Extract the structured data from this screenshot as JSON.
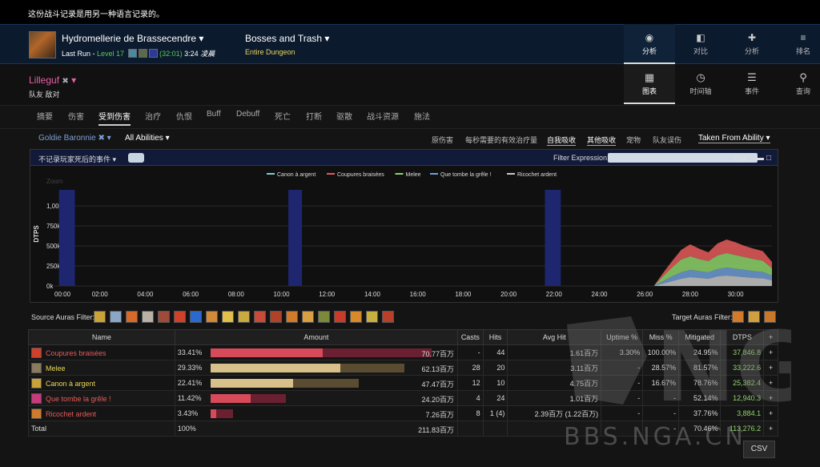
{
  "notice": "这份战斗记录是用另一种语言记录的。",
  "fight": {
    "boss_name": "Hydromellerie de Brassecendre ▾",
    "last_run": "Last Run",
    "level": "Level 17",
    "timer": "(32:01)",
    "duration": "3:24",
    "time_suffix": "凌晨",
    "category": "Bosses and Trash ▾",
    "scope": "Entire Dungeon"
  },
  "topnav": [
    {
      "label": "分析",
      "icon": "eye-icon"
    },
    {
      "label": "对比",
      "icon": "compare-icon"
    },
    {
      "label": "分析",
      "icon": "puzzle-icon"
    },
    {
      "label": "排名",
      "icon": "rank-icon"
    }
  ],
  "player": {
    "name": "Lilleguf",
    "menu": "▾",
    "sub": "队友  敌对"
  },
  "viewnav": [
    {
      "label": "图表",
      "icon": "grid-icon"
    },
    {
      "label": "时间轴",
      "icon": "clock-icon"
    },
    {
      "label": "事件",
      "icon": "list-icon"
    },
    {
      "label": "查询",
      "icon": "pin-icon"
    }
  ],
  "tabs": [
    "摘要",
    "伤害",
    "受到伤害",
    "治疗",
    "仇恨",
    "Buff",
    "Debuff",
    "死亡",
    "打断",
    "驱散",
    "战斗资源",
    "施法"
  ],
  "filters": {
    "target": "Goldie Baronnie ✖ ▾",
    "abilities": "All Abilities ▾",
    "options": [
      "原伤害",
      "每秒需要的有效治疗量",
      "自我吸收",
      "其他吸收",
      "宠物",
      "队友误伤"
    ],
    "taken_from": "Taken From Ability ▾"
  },
  "chart_header": {
    "death_events": "不记录玩家死后的事件 ▾",
    "filter_expression": "Filter Expression:"
  },
  "chart_data": {
    "type": "area",
    "ylabel": "DTPS",
    "zoom_label": "Zoom",
    "yticks": [
      "0k",
      "250k",
      "500k",
      "750k",
      "1,000k"
    ],
    "xticks": [
      "00:00",
      "02:00",
      "04:00",
      "06:00",
      "08:00",
      "10:00",
      "12:00",
      "14:00",
      "16:00",
      "18:00",
      "20:00",
      "22:00",
      "24:00",
      "26:00",
      "28:00",
      "30:00"
    ],
    "xlim": [
      0,
      31.6
    ],
    "ylim": [
      0,
      1200000
    ],
    "highlight_ranges": [
      [
        0.2,
        0.9
      ],
      [
        10.3,
        10.9
      ],
      [
        21.6,
        22.3
      ]
    ],
    "series": [
      {
        "name": "Canon à argent",
        "color": "#7fcfcf"
      },
      {
        "name": "Coupures braisées",
        "color": "#e65a5a"
      },
      {
        "name": "Melee",
        "color": "#8fd46a"
      },
      {
        "name": "Que tombe la grêle !",
        "color": "#6f9fd8"
      },
      {
        "name": "Ricochet ardent",
        "color": "#c8c8c8"
      }
    ],
    "x": [
      26.4,
      26.8,
      27.2,
      27.6,
      28.0,
      28.4,
      28.8,
      29.2,
      29.6,
      30.0,
      30.4,
      30.8,
      31.2,
      31.6
    ],
    "stack_values": [
      [
        0,
        0,
        0,
        0,
        0,
        0,
        0,
        0,
        0,
        0,
        0,
        0,
        0,
        0
      ],
      [
        0,
        40000,
        80000,
        120000,
        150000,
        130000,
        110000,
        150000,
        170000,
        160000,
        140000,
        130000,
        120000,
        80000
      ],
      [
        0,
        60000,
        110000,
        160000,
        170000,
        150000,
        140000,
        170000,
        180000,
        170000,
        160000,
        150000,
        140000,
        90000
      ],
      [
        0,
        30000,
        60000,
        80000,
        90000,
        85000,
        80000,
        90000,
        100000,
        95000,
        90000,
        85000,
        80000,
        60000
      ],
      [
        0,
        30000,
        60000,
        90000,
        110000,
        100000,
        90000,
        120000,
        130000,
        120000,
        110000,
        100000,
        95000,
        70000
      ]
    ]
  },
  "auras": {
    "source_label": "Source Auras Filter:",
    "target_label": "Target Auras Filter:",
    "source_colors": [
      "#c9a23a",
      "#8aa7c8",
      "#d66a2a",
      "#b9b1a6",
      "#a04a3a",
      "#d0402a",
      "#2a6ad0",
      "#d08a3a",
      "#e0c04a",
      "#c8aa40",
      "#c84a3a",
      "#b0422a",
      "#d07a2a",
      "#d8a040",
      "#7a8a3a",
      "#c83a2a",
      "#d88a2a",
      "#c8b040",
      "#b8402a"
    ],
    "target_colors": [
      "#d07a2a",
      "#d0a040",
      "#c8782a"
    ]
  },
  "table": {
    "headers": [
      "Name",
      "Amount",
      "Casts",
      "Hits",
      "Avg Hit",
      "Uptime %",
      "Miss %",
      "Mitigated",
      "DTPS",
      "+"
    ],
    "rows": [
      {
        "name": "Coupures braisées",
        "color": "#e65a5a",
        "icon": "#d0402a",
        "pct": "33.41%",
        "amount": "70.77百万",
        "share": 1.0,
        "shareLight": 0.51,
        "barColor": "#d64a5a",
        "barBg": "#6a2030",
        "casts": "-",
        "hits": "44",
        "avg": "1.61百万",
        "uptime": "3.30%",
        "miss": "100.00%",
        "mitigated": "24.95%",
        "dtps": "37,846.8",
        "plus": "+"
      },
      {
        "name": "Melee",
        "color": "#e8d65b",
        "icon": "#8a7a60",
        "pct": "29.33%",
        "amount": "62.13百万",
        "share": 0.878,
        "shareLight": 0.67,
        "barColor": "#d8c08a",
        "barBg": "#5a4c30",
        "casts": "28",
        "hits": "20",
        "avg": "3.11百万",
        "uptime": "-",
        "miss": "28.57%",
        "mitigated": "81.57%",
        "dtps": "33,222.6",
        "plus": "+"
      },
      {
        "name": "Canon à argent",
        "color": "#e8d65b",
        "icon": "#c9a23a",
        "pct": "22.41%",
        "amount": "47.47百万",
        "share": 0.671,
        "shareLight": 0.56,
        "barColor": "#d8c08a",
        "barBg": "#5a4c30",
        "casts": "12",
        "hits": "10",
        "avg": "4.75百万",
        "uptime": "-",
        "miss": "16.67%",
        "mitigated": "78.76%",
        "dtps": "25,382.4",
        "plus": "+"
      },
      {
        "name": "Que tombe la grêle !",
        "color": "#e65a5a",
        "icon": "#c83a7a",
        "pct": "11.42%",
        "amount": "24.20百万",
        "share": 0.342,
        "shareLight": 0.53,
        "barColor": "#d64a5a",
        "barBg": "#6a2030",
        "casts": "4",
        "hits": "24",
        "avg": "1.01百万",
        "uptime": "-",
        "miss": "-",
        "mitigated": "52.14%",
        "dtps": "12,940.3",
        "plus": "+"
      },
      {
        "name": "Ricochet ardent",
        "color": "#e65a5a",
        "icon": "#d07a2a",
        "pct": "3.43%",
        "amount": "7.26百万",
        "share": 0.103,
        "shareLight": 0.25,
        "barColor": "#d64a5a",
        "barBg": "#6a2030",
        "casts": "8",
        "hits": "1 (4)",
        "avg": "2.39百万 (1.22百万)",
        "uptime": "-",
        "miss": "-",
        "mitigated": "37.76%",
        "dtps": "3,884.1",
        "plus": "+"
      }
    ],
    "total": {
      "name": "Total",
      "pct": "100%",
      "amount": "211.83百万",
      "casts": "",
      "hits": "",
      "avg": "",
      "uptime": "",
      "miss": "-",
      "mitigated": "70.46%",
      "dtps": "113,276.2",
      "plus": "+"
    }
  },
  "csv_label": "CSV",
  "watermark": "BBS.NGA.CN"
}
